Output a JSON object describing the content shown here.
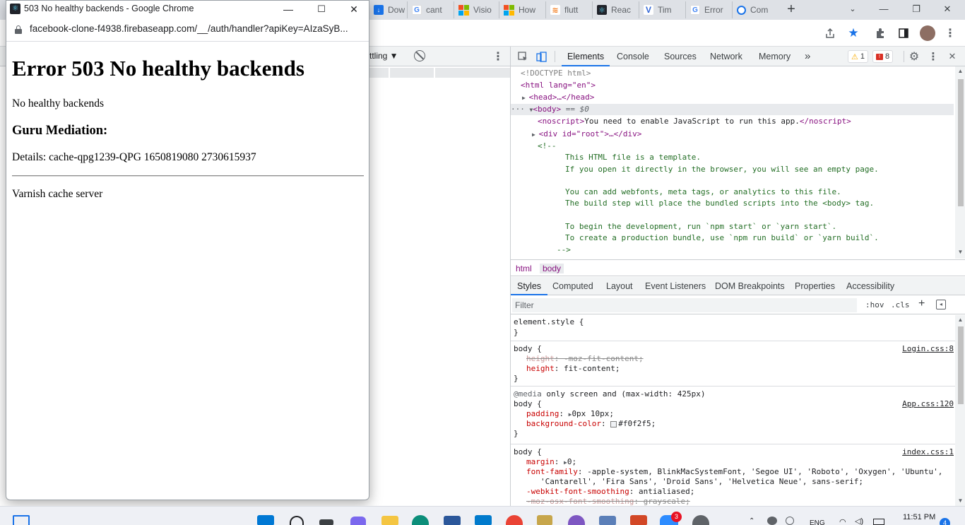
{
  "browser_tabs": [
    {
      "label": "Dow",
      "icon": "download-favicon-icon"
    },
    {
      "label": "cant",
      "icon": "google-favicon-icon"
    },
    {
      "label": "Visio",
      "icon": "microsoft-favicon-icon"
    },
    {
      "label": "How",
      "icon": "microsoft-favicon-icon"
    },
    {
      "label": "flutt",
      "icon": "stackoverflow-favicon-icon"
    },
    {
      "label": "Reac",
      "icon": "react-favicon-icon"
    },
    {
      "label": "Tim",
      "icon": "v-favicon-icon"
    },
    {
      "label": "Error",
      "icon": "google-favicon-icon"
    },
    {
      "label": "Com",
      "icon": "circle-favicon-icon"
    }
  ],
  "popup": {
    "title": "503 No healthy backends - Google Chrome",
    "url": "facebook-clone-f4938.firebaseapp.com/__/auth/handler?apiKey=AIzaSyB...",
    "heading": "Error 503 No healthy backends",
    "message": "No healthy backends",
    "subheading": "Guru Mediation:",
    "details": "Details: cache-qpg1239-QPG 1650819080 2730615937",
    "footer": "Varnish cache server"
  },
  "device_toolbar": {
    "throttle_label": "ttling ▼"
  },
  "devtools": {
    "tabs": [
      "Elements",
      "Console",
      "Sources",
      "Network",
      "Memory"
    ],
    "more_tabs": "»",
    "warnings": "1",
    "errors": "8",
    "tree": {
      "doctype": "<!DOCTYPE html>",
      "html_open": "<html lang=\"en\">",
      "head": "<head>…</head>",
      "body_open": "<body>",
      "body_eq": " == $0",
      "noscript_text": "You need to enable JavaScript to run this app.",
      "div_root": "<div id=\"root\">…</div>",
      "comment_open": "<!--",
      "comment_lines": [
        "This HTML file is a template.",
        "If you open it directly in the browser, you will see an empty page.",
        "",
        "You can add webfonts, meta tags, or analytics to this file.",
        "The build step will place the bundled scripts into the <body> tag.",
        "",
        "To begin the development, run `npm start` or `yarn start`.",
        "To create a production bundle, use `npm run build` or `yarn build`."
      ],
      "comment_close": "-->"
    },
    "breadcrumbs": [
      "html",
      "body"
    ],
    "sub_tabs": [
      "Styles",
      "Computed",
      "Layout",
      "Event Listeners",
      "DOM Breakpoints",
      "Properties",
      "Accessibility"
    ],
    "filter_placeholder": "Filter",
    "hov": ":hov",
    "cls": ".cls",
    "styles": {
      "element_style": "element.style {",
      "rule1": {
        "selector": "body {",
        "source": "Login.css:8",
        "strike_prop": "height",
        "strike_val": "-moz-fit-content;",
        "prop": "height",
        "val": "fit-content;"
      },
      "rule2": {
        "media": "@media",
        "media_query": " only screen and (max-width: 425px)",
        "selector": "body {",
        "source": "App.css:120",
        "prop1": "padding",
        "val1": "0px 10px;",
        "prop2": "background-color",
        "val2": "#f0f2f5;",
        "swatch": "#f0f2f5"
      },
      "rule3": {
        "selector": "body {",
        "source": "index.css:1",
        "prop1": "margin",
        "val1": "0;",
        "prop2": "font-family",
        "val2": "-apple-system, BlinkMacSystemFont, 'Segoe UI', 'Roboto', 'Oxygen', 'Ubuntu',",
        "val2b": "'Cantarell', 'Fira Sans', 'Droid Sans', 'Helvetica Neue', sans-serif;",
        "prop3": "-webkit-font-smoothing",
        "val3": "antialiased;",
        "prop4": "-moz-osx-font-smoothing",
        "val4": "grayscale;"
      },
      "close": "}"
    }
  },
  "taskbar": {
    "time": "11:51 PM",
    "lang": "ENG",
    "notification_count": "3",
    "chat_count": "4"
  },
  "colors": {
    "accent": "#1a73e8",
    "tag": "#881280",
    "comment": "#236e25",
    "error_badge": "#d93025",
    "warning_badge": "#f9ab00"
  }
}
